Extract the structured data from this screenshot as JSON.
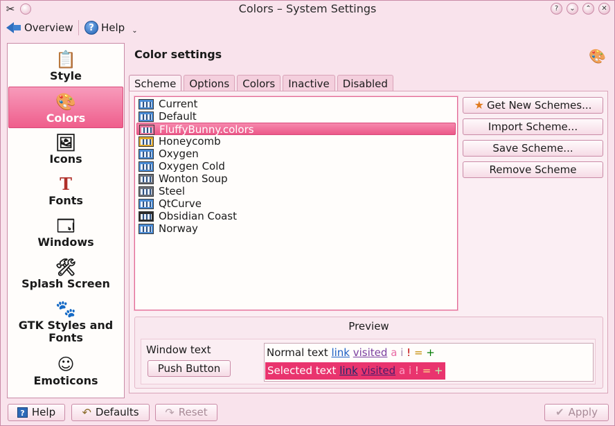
{
  "window": {
    "title": "Colors – System Settings"
  },
  "toolbar": {
    "overview_label": "Overview",
    "help_label": "Help"
  },
  "sidebar": {
    "items": [
      {
        "label": "Style",
        "icon": "style-icon"
      },
      {
        "label": "Colors",
        "icon": "colors-icon",
        "active": true
      },
      {
        "label": "Icons",
        "icon": "icons-icon"
      },
      {
        "label": "Fonts",
        "icon": "fonts-icon"
      },
      {
        "label": "Windows",
        "icon": "windows-icon"
      },
      {
        "label": "Splash Screen",
        "icon": "splash-screen-icon"
      },
      {
        "label": "GTK Styles and Fonts",
        "icon": "gtk-icon"
      },
      {
        "label": "Emoticons",
        "icon": "emoticons-icon"
      }
    ]
  },
  "content": {
    "title": "Color settings"
  },
  "tabs": [
    {
      "label": "Scheme",
      "active": true
    },
    {
      "label": "Options"
    },
    {
      "label": "Colors"
    },
    {
      "label": "Inactive"
    },
    {
      "label": "Disabled"
    }
  ],
  "schemes": [
    "Current",
    "Default",
    "FluffyBunny.colors",
    "Honeycomb",
    "Oxygen",
    "Oxygen Cold",
    "Wonton Soup",
    "Steel",
    "QtCurve",
    "Obsidian Coast",
    "Norway"
  ],
  "selected_scheme": "FluffyBunny.colors",
  "scheme_buttons": {
    "get_new": "Get New Schemes...",
    "import": "Import Scheme...",
    "save": "Save Scheme...",
    "remove": "Remove Scheme"
  },
  "preview": {
    "title": "Preview",
    "window_text": "Window text",
    "push_button": "Push Button",
    "normal_text": "Normal text",
    "selected_text": "Selected text",
    "link": "link",
    "visited": "visited",
    "active": "a",
    "inactive": "i",
    "negative": "!",
    "neutral": "=",
    "positive": "+"
  },
  "bottom": {
    "help": "Help",
    "defaults": "Defaults",
    "reset": "Reset",
    "apply": "Apply"
  },
  "colors": {
    "accent": "#ec5889",
    "selection": "#e9346e",
    "window_bg": "#f9e3ec"
  }
}
